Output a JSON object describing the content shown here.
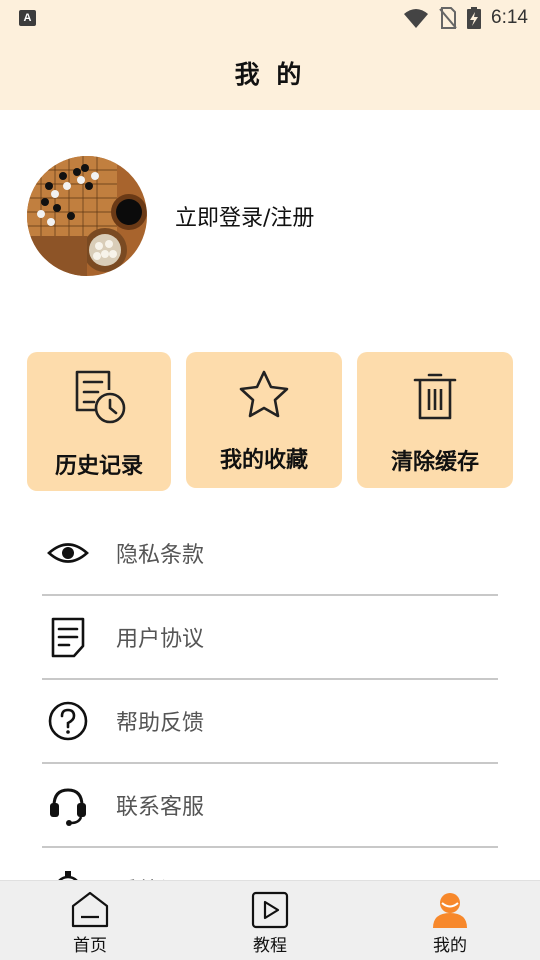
{
  "status_bar": {
    "notification_icon": "A",
    "time": "6:14",
    "icons": [
      "wifi-icon",
      "no-sim-icon",
      "battery-charging-icon"
    ]
  },
  "header": {
    "title": "我 的"
  },
  "profile": {
    "avatar_icon": "avatar-go-board-image",
    "login_label": "立即登录/注册"
  },
  "quick_actions": [
    {
      "label": "历史记录",
      "icon": "history-icon"
    },
    {
      "label": "我的收藏",
      "icon": "star-icon"
    },
    {
      "label": "清除缓存",
      "icon": "trash-icon"
    }
  ],
  "menu": [
    {
      "label": "隐私条款",
      "icon": "eye-icon"
    },
    {
      "label": "用户协议",
      "icon": "document-icon"
    },
    {
      "label": "帮助反馈",
      "icon": "question-icon"
    },
    {
      "label": "联系客服",
      "icon": "headset-icon"
    },
    {
      "label": "系统设置",
      "icon": "gear-icon"
    }
  ],
  "tabs": [
    {
      "label": "首页",
      "icon": "home-icon",
      "active": false
    },
    {
      "label": "教程",
      "icon": "play-icon",
      "active": false
    },
    {
      "label": "我的",
      "icon": "user-icon",
      "active": true
    }
  ],
  "colors": {
    "header_bg": "#fdf0dc",
    "card_bg": "#fddcac",
    "accent": "#f7882b",
    "divider": "#c8c8c8"
  }
}
